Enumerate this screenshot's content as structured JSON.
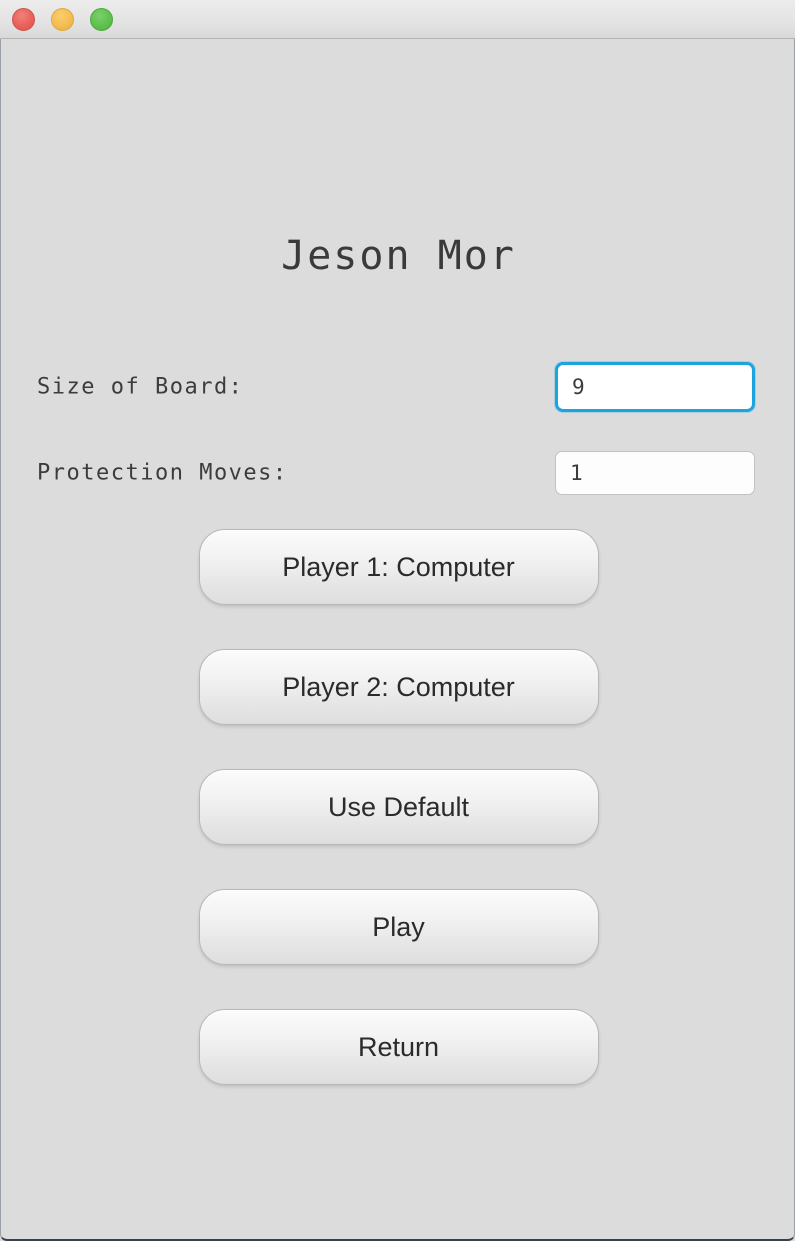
{
  "window": {
    "titlebar": {
      "close_label": "close",
      "minimize_label": "minimize",
      "maximize_label": "maximize",
      "colors": {
        "close": "#e8615a",
        "minimize": "#f5bd4f",
        "maximize": "#5fc14e"
      }
    },
    "background_color": "#dcdcdc"
  },
  "app": {
    "title": "Jeson Mor"
  },
  "form": {
    "fields": [
      {
        "label": "Size of Board:",
        "value": "9",
        "placeholder": "",
        "focused": true
      },
      {
        "label": "Protection Moves:",
        "value": "1",
        "placeholder": "",
        "focused": false
      }
    ],
    "focus_ring_color": "#1ba4de"
  },
  "buttons": [
    {
      "label": "Player 1: Computer"
    },
    {
      "label": "Player 2: Computer"
    },
    {
      "label": "Use Default"
    },
    {
      "label": "Play"
    },
    {
      "label": "Return"
    }
  ]
}
